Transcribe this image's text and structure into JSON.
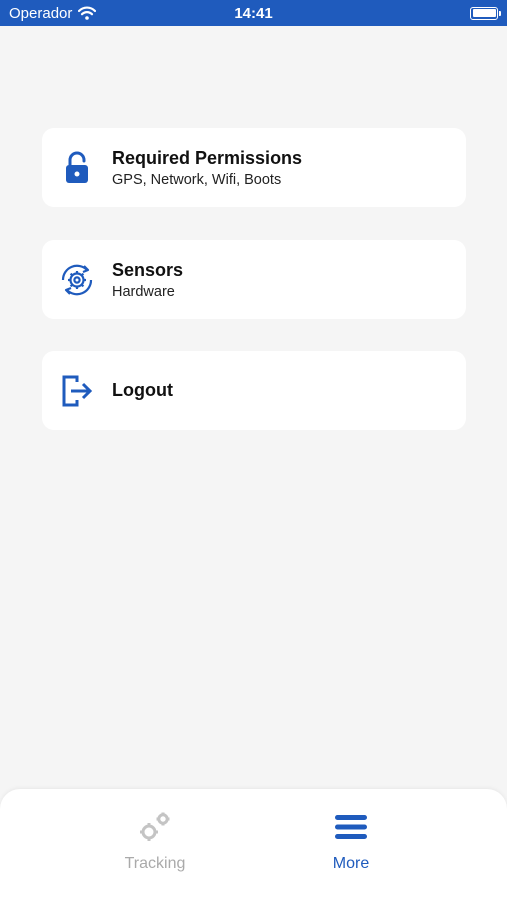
{
  "status_bar": {
    "carrier": "Operador",
    "time": "14:41"
  },
  "menu": [
    {
      "title": "Required Permissions",
      "subtitle": "GPS, Network, Wifi, Boots",
      "icon": "lock-icon"
    },
    {
      "title": "Sensors",
      "subtitle": "Hardware",
      "icon": "sensor-gear-icon"
    },
    {
      "title": "Logout",
      "subtitle": "",
      "icon": "logout-icon"
    }
  ],
  "tab_bar": {
    "tabs": [
      {
        "label": "Tracking",
        "icon": "gears-icon",
        "active": false
      },
      {
        "label": "More",
        "icon": "menu-icon",
        "active": true
      }
    ]
  },
  "colors": {
    "accent": "#1f5bbd",
    "inactive": "#aaaaaa",
    "background": "#f5f5f5"
  }
}
